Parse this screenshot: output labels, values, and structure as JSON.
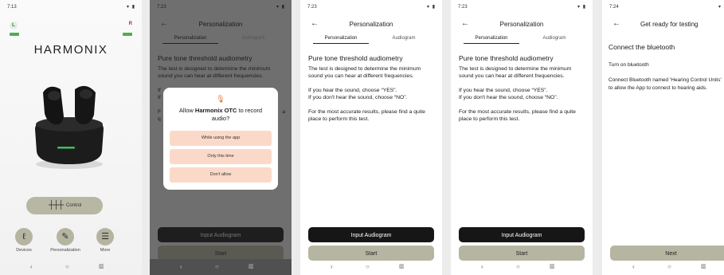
{
  "screen1": {
    "time": "7:13",
    "status_right": "▾ ▮",
    "left_ear": "L",
    "right_ear": "R",
    "brand": "HARMONIX",
    "control_label": "Control",
    "tabs": [
      {
        "label": "Devices",
        "icon": "ear-icon",
        "glyph": "ℓ"
      },
      {
        "label": "Personalization",
        "icon": "edit-icon",
        "glyph": "✎"
      },
      {
        "label": "More",
        "icon": "menu-icon",
        "glyph": "☰"
      }
    ]
  },
  "screen2": {
    "time": "7:23",
    "title": "Personalization",
    "tab_personalization": "Personalization",
    "tab_audiogram": "Audiogram",
    "heading": "Pure tone threshold audiometry",
    "para1": "The test is designed to determine the minimum sound you can hear at different frequencies.",
    "para2_frag": "If",
    "para3_frag": "If",
    "para4_frag": "F",
    "para4_tail": "a",
    "para5_frag": "q",
    "dialog": {
      "question_pre": "Allow ",
      "app_name": "Harmonix OTC",
      "question_post": " to record audio?",
      "opt1": "While using the app",
      "opt2": "Only this time",
      "opt3": "Don't allow"
    },
    "input_label": "Input Audiogram",
    "start_label": "Start"
  },
  "screen3": {
    "time": "7:23",
    "title": "Personalization",
    "tab_personalization": "Personalization",
    "tab_audiogram": "Audiogram",
    "heading": "Pure tone threshold audiometry",
    "para1": "The test is designed to determine the minimum sound you can hear at different frequencies.",
    "para2a": "If you hear the sound, choose “YES”.",
    "para2b": "If you don't hear the sound, choose “NO”.",
    "para3": "For the most accurate results, please find a quite place to perform this test.",
    "input_label": "Input Audiogram",
    "start_label": "Start"
  },
  "screen4": {
    "time": "7:23",
    "title": "Personalization",
    "tab_personalization": "Personalization",
    "tab_audiogram": "Audiogram",
    "heading": "Pure tone threshold audiometry",
    "para1": "The test is designed to determine the minimum sound you can hear at different frequencies.",
    "para2a": "If you hear the sound, choose “YES”.",
    "para2b": "If you don't hear the sound, choose “NO”.",
    "para3": "For the most accurate results, please find a quite place to perform this test.",
    "input_label": "Input Audiogram",
    "start_label": "Start"
  },
  "screen5": {
    "time": "7:24",
    "title": "Get ready for testing",
    "heading": "Connect the bluetooth",
    "para1": "Turn on bluetooth",
    "para2": "Connect Bluetooth named 'Hearing Control Units' to allow the App to connect to hearing aids.",
    "next_label": "Next"
  },
  "nav": {
    "back": "‹",
    "home": "○",
    "recents": "▥"
  },
  "colors": {
    "accent_button": "#b5b5a2",
    "dark_button": "#161616",
    "dialog_option": "#fbd9c9",
    "mic": "#e0703a"
  }
}
